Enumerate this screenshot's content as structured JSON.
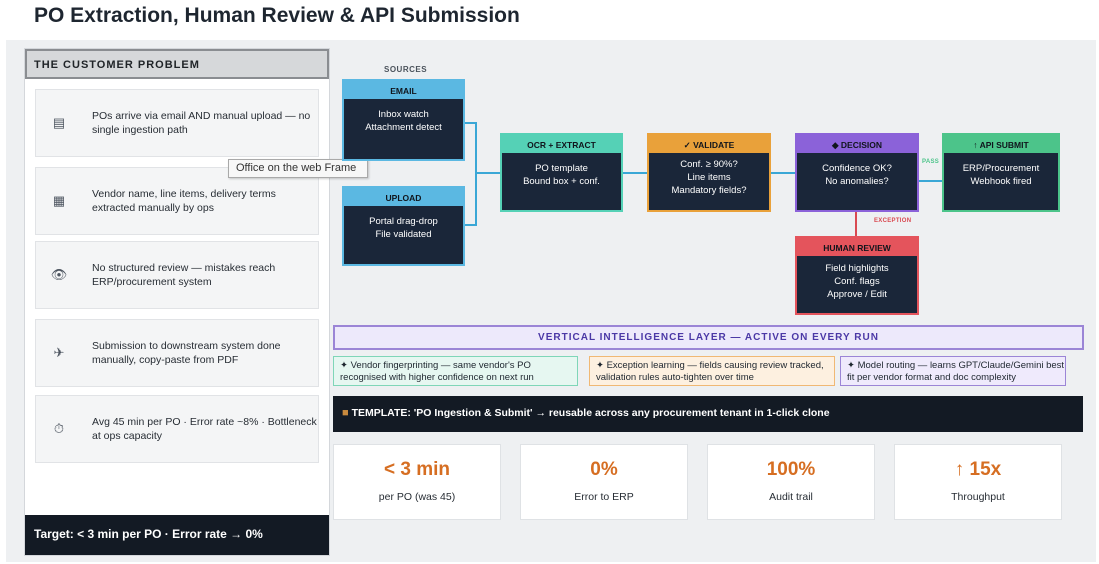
{
  "page": {
    "title": "PO Extraction, Human Review & API Submission"
  },
  "problem": {
    "header": "THE CUSTOMER PROBLEM",
    "items": [
      {
        "icon": "email-icon",
        "glyph": "▤",
        "text": "POs arrive via email AND manual upload — no single ingestion path"
      },
      {
        "icon": "document-icon",
        "glyph": "▦",
        "text": "Vendor name, line items, delivery terms extracted manually by ops"
      },
      {
        "icon": "eye-icon",
        "glyph": "👁",
        "text": "No structured review — mistakes reach ERP/procurement system"
      },
      {
        "icon": "satellite-icon",
        "glyph": "✈",
        "text": "Submission to downstream system done manually, copy-paste from PDF"
      },
      {
        "icon": "stopwatch-icon",
        "glyph": "⏱",
        "text": "Avg 45 min per PO · Error rate ~8% · Bottleneck at ops capacity"
      }
    ],
    "target": "Target: < 3 min per PO · Error rate → 0%"
  },
  "tooltip": "Office on the web Frame",
  "flow": {
    "sources_label": "SOURCES",
    "email": {
      "title": "EMAIL",
      "lines": [
        "Inbox watch",
        "Attachment detect"
      ]
    },
    "upload": {
      "title": "UPLOAD",
      "lines": [
        "Portal drag-drop",
        "File validated"
      ]
    },
    "ocr": {
      "title": "OCR + EXTRACT",
      "lines": [
        "PO template",
        "Bound box + conf."
      ]
    },
    "validate": {
      "title": "✓ VALIDATE",
      "lines": [
        "Conf. ≥ 90%?",
        "Line items",
        "Mandatory fields?"
      ]
    },
    "decision": {
      "title": "◆ DECISION",
      "lines": [
        "Confidence OK?",
        "No anomalies?"
      ]
    },
    "api": {
      "title": "↑ API SUBMIT",
      "lines": [
        "ERP/Procurement",
        "Webhook fired"
      ]
    },
    "review": {
      "title": "HUMAN REVIEW",
      "lines": [
        "Field highlights",
        "Conf. flags",
        "Approve / Edit"
      ]
    },
    "pass_label": "PASS",
    "exception_label": "EXCEPTION",
    "colors": {
      "email": "#5bb8e2",
      "upload": "#5bb8e2",
      "ocr": "#55d1b6",
      "validate": "#e9a13a",
      "decision": "#8b62d9",
      "api": "#4cc48a",
      "review": "#e4545c",
      "wire_blue": "#3aa7d6",
      "wire_red": "#d94a52"
    }
  },
  "intelligence": {
    "title": "VERTICAL INTELLIGENCE LAYER — ACTIVE ON EVERY RUN",
    "cards": [
      {
        "text": "✦ Vendor fingerprinting — same vendor's PO recognised with higher confidence on next run"
      },
      {
        "text": "✦ Exception learning — fields causing review tracked, validation rules auto-tighten over time"
      },
      {
        "text": "✦ Model routing — learns GPT/Claude/Gemini best fit per vendor format and doc complexity"
      }
    ]
  },
  "template": {
    "icon": "package-icon",
    "glyph": "■",
    "text": "TEMPLATE: 'PO Ingestion & Submit' → reusable across any procurement tenant in 1-click clone"
  },
  "stats": [
    {
      "value": "< 3 min",
      "label": "per PO (was 45)"
    },
    {
      "value": "0%",
      "label": "Error to ERP"
    },
    {
      "value": "100%",
      "label": "Audit trail"
    },
    {
      "value": "↑ 15x",
      "label": "Throughput"
    }
  ]
}
